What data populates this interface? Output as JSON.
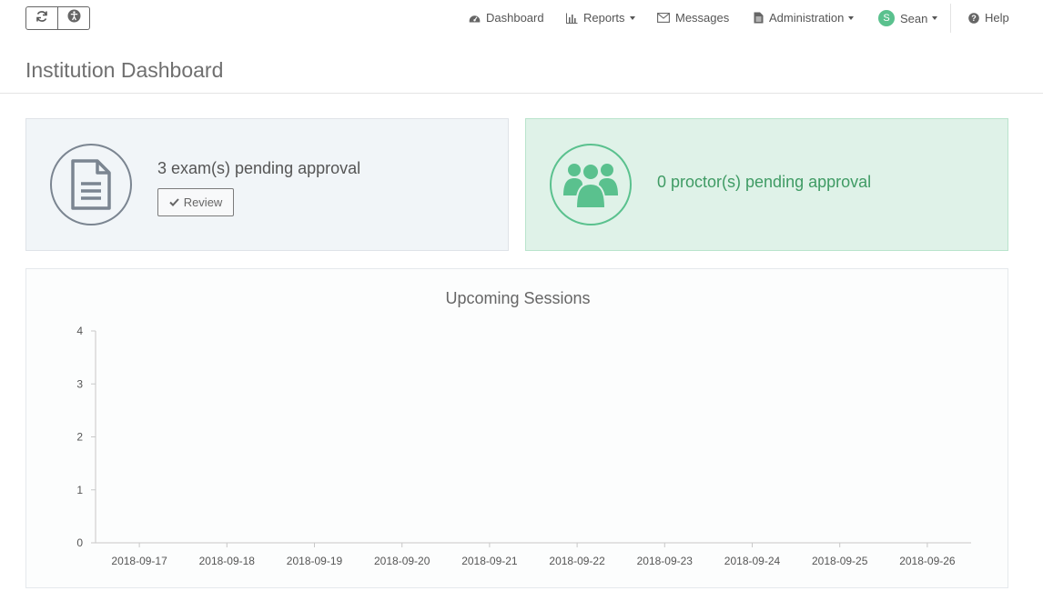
{
  "toolbar": {
    "icons": [
      "refresh-icon",
      "accessibility-icon"
    ]
  },
  "nav": {
    "dashboard": "Dashboard",
    "reports": "Reports",
    "messages": "Messages",
    "administration": "Administration",
    "user_initial": "S",
    "user_name": "Sean",
    "help": "Help"
  },
  "page": {
    "title": "Institution Dashboard"
  },
  "exam_card": {
    "text": "3 exam(s) pending approval",
    "review_label": "Review",
    "icon": "document-icon"
  },
  "proctor_card": {
    "text": "0 proctor(s) pending approval",
    "icon": "users-icon"
  },
  "colors": {
    "accent_green": "#5ac18e",
    "proctor_text": "#3f9b64",
    "proctor_bg": "#dff2e8",
    "exam_bg": "#f1f5f8"
  },
  "chart_data": {
    "type": "line",
    "title": "Upcoming Sessions",
    "x": [
      "2018-09-17",
      "2018-09-18",
      "2018-09-19",
      "2018-09-20",
      "2018-09-21",
      "2018-09-22",
      "2018-09-23",
      "2018-09-24",
      "2018-09-25",
      "2018-09-26"
    ],
    "series": [
      {
        "values": []
      }
    ],
    "yticks": [
      "0",
      "1",
      "2",
      "3",
      "4"
    ],
    "ylim": [
      0,
      4
    ],
    "xlabel": "",
    "ylabel": "",
    "grid": false
  }
}
